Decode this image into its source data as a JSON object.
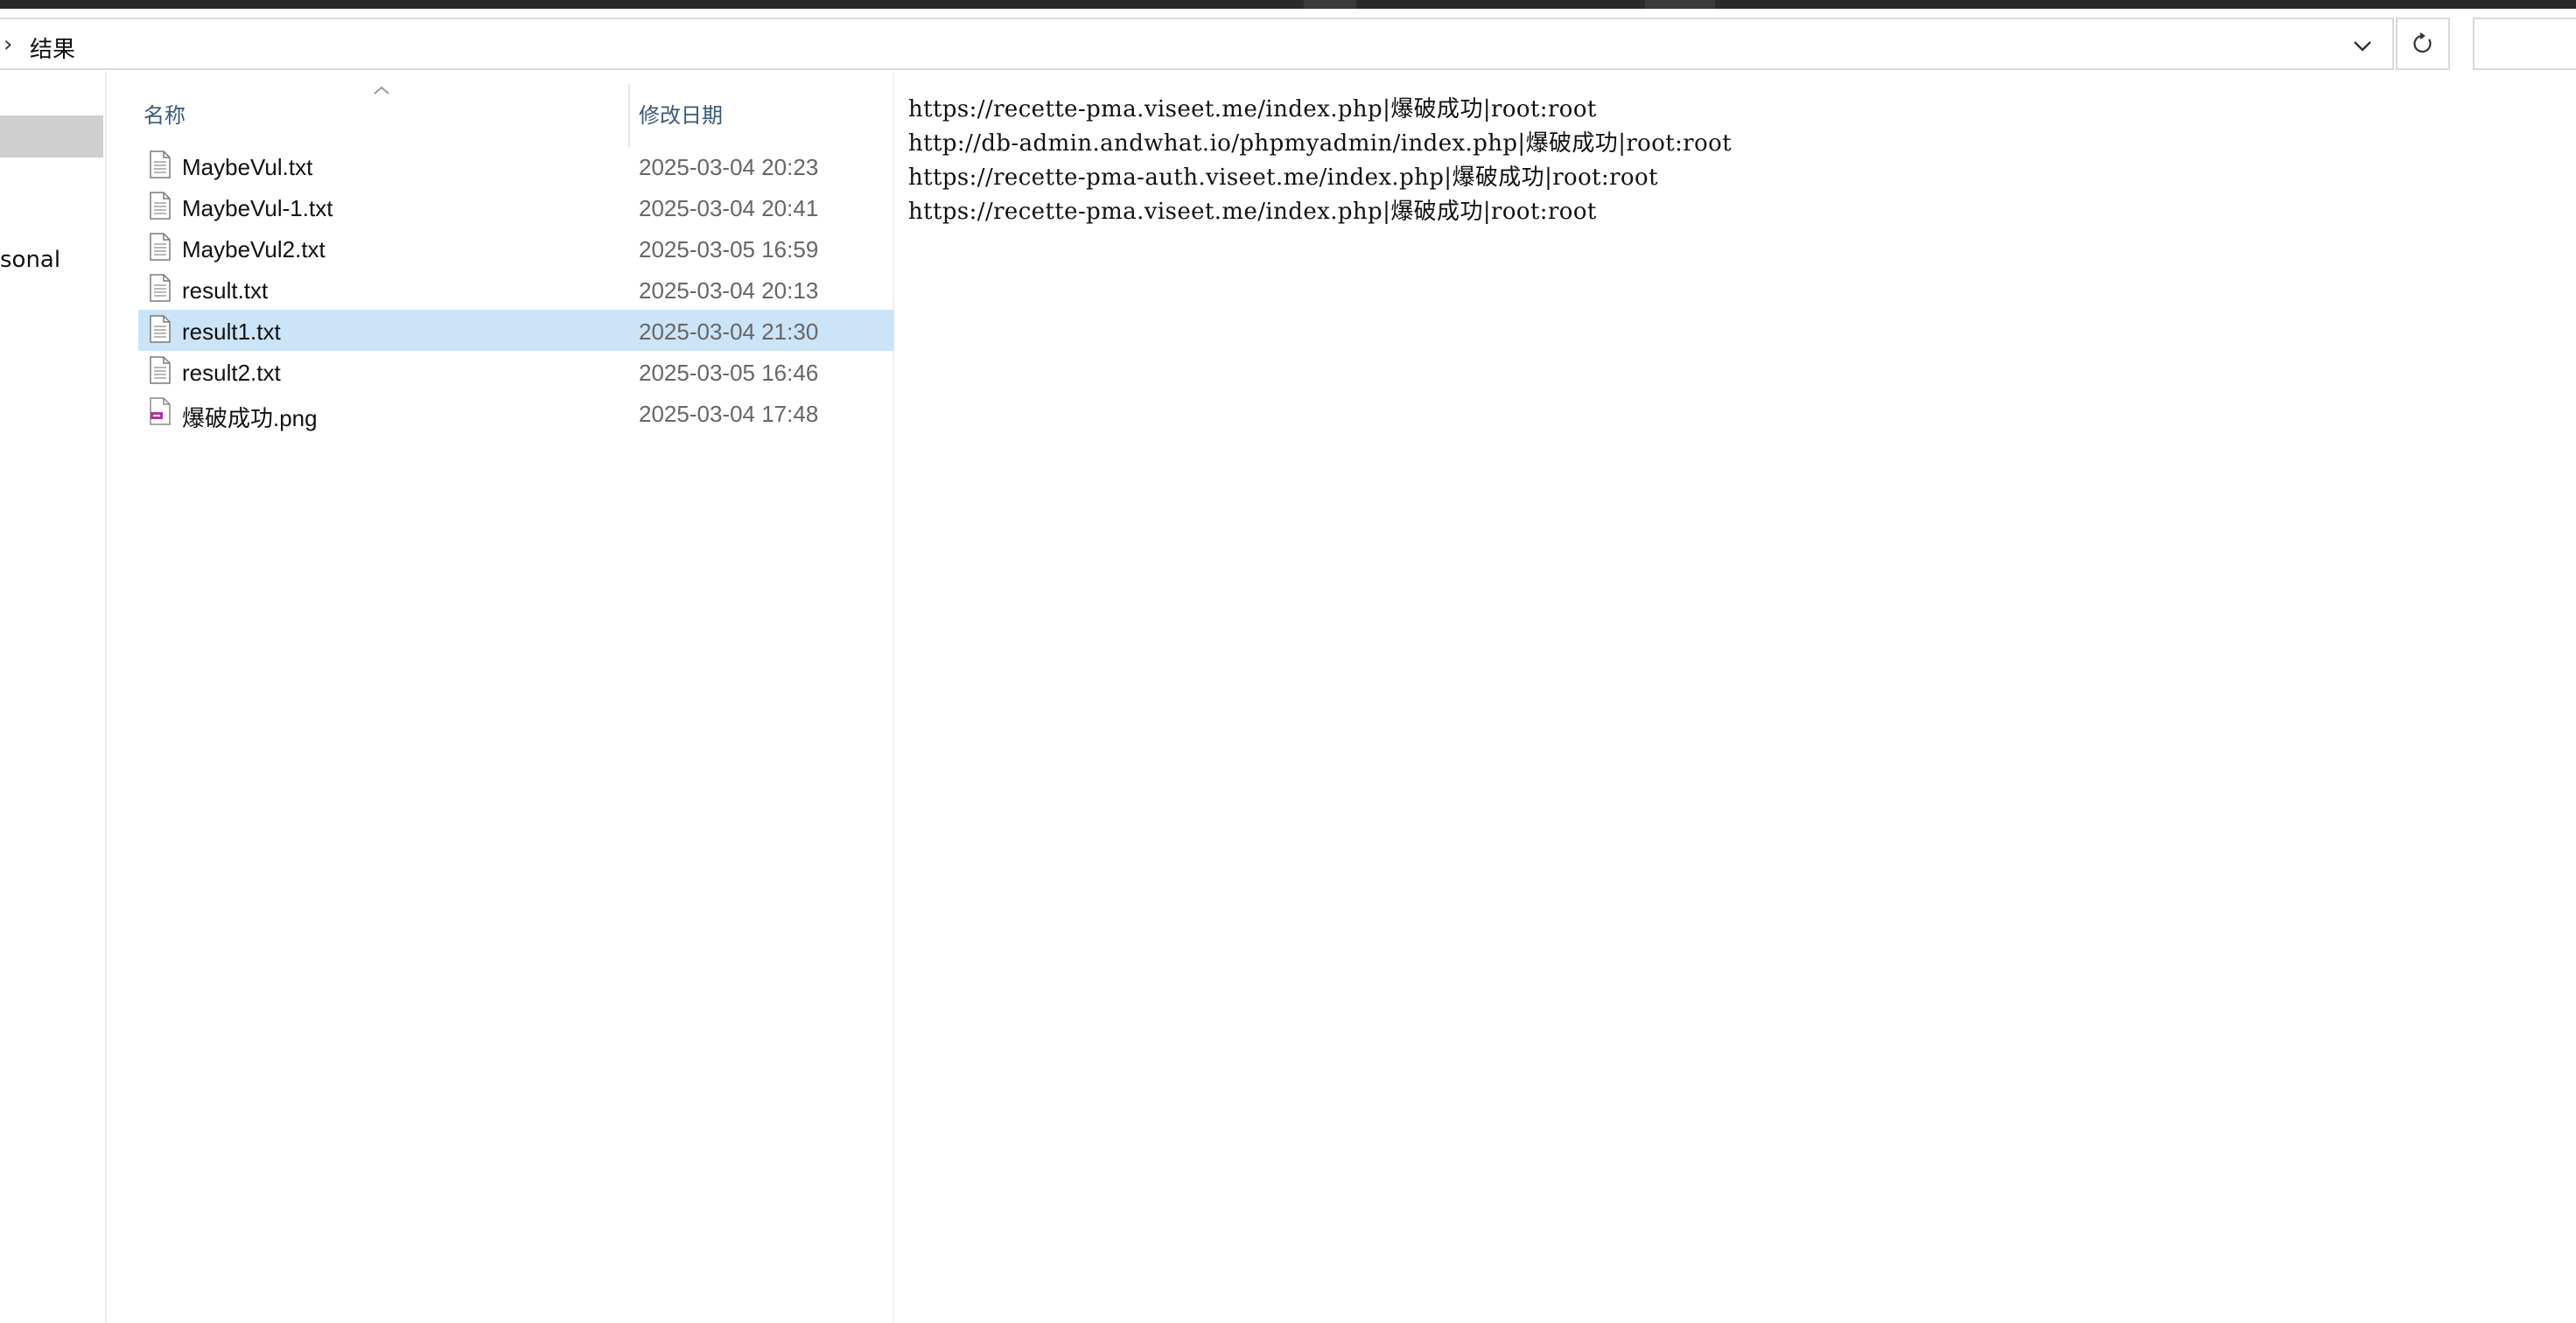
{
  "address_bar": {
    "path": "结果"
  },
  "nav_pane": {
    "items": [
      {
        "label": ""
      },
      {
        "label": "sonal"
      }
    ]
  },
  "file_list": {
    "columns": [
      {
        "label": "名称"
      },
      {
        "label": "修改日期"
      }
    ],
    "sort_column": "名称",
    "selected_index": 4,
    "files": [
      {
        "name": "MaybeVul.txt",
        "modified": "2025-03-04 20:23",
        "icon": "text-file-icon"
      },
      {
        "name": "MaybeVul-1.txt",
        "modified": "2025-03-04 20:41",
        "icon": "text-file-icon"
      },
      {
        "name": "MaybeVul2.txt",
        "modified": "2025-03-05 16:59",
        "icon": "text-file-icon"
      },
      {
        "name": "result.txt",
        "modified": "2025-03-04 20:13",
        "icon": "text-file-icon"
      },
      {
        "name": "result1.txt",
        "modified": "2025-03-04 21:30",
        "icon": "text-file-icon"
      },
      {
        "name": "result2.txt",
        "modified": "2025-03-05 16:46",
        "icon": "text-file-icon"
      },
      {
        "name": "爆破成功.png",
        "modified": "2025-03-04 17:48",
        "icon": "image-file-icon"
      }
    ]
  },
  "preview": {
    "lines": [
      "https://recette-pma.viseet.me/index.php|爆破成功|root:root",
      "http://db-admin.andwhat.io/phpmyadmin/index.php|爆破成功|root:root",
      "https://recette-pma-auth.viseet.me/index.php|爆破成功|root:root",
      "https://recette-pma.viseet.me/index.php|爆破成功|root:root"
    ]
  },
  "colors": {
    "selection": "#cce4f7",
    "header_text": "#3a5a7a",
    "date_text": "#666666",
    "border": "#d9d9d9",
    "image_icon_accent": "#b0339c"
  }
}
